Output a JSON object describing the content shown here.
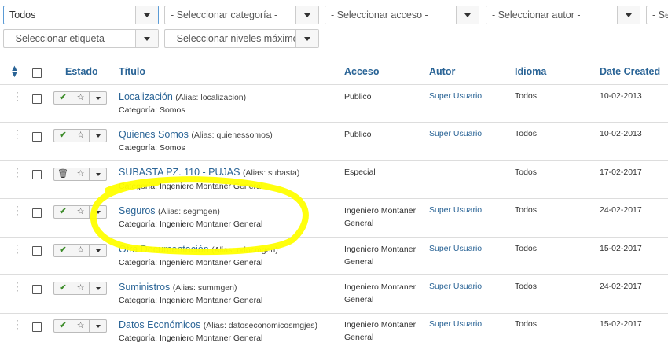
{
  "filters": {
    "status": "Todos",
    "category": "- Seleccionar categoría -",
    "access": "- Seleccionar acceso -",
    "author": "- Seleccionar autor -",
    "language_partial": "- Se",
    "tag": "- Seleccionar etiqueta -",
    "levels": "- Seleccionar niveles máximos"
  },
  "headers": {
    "estado": "Estado",
    "titulo": "Título",
    "acceso": "Acceso",
    "autor": "Autor",
    "idioma": "Idioma",
    "date": "Date Created"
  },
  "rows": [
    {
      "title": "Localización",
      "alias": "(Alias: localizacion)",
      "category": "Categoría: Somos",
      "access": "Publico",
      "author": "Super Usuario",
      "language": "Todos",
      "date": "10-02-2013",
      "state": "published"
    },
    {
      "title": "Quienes Somos",
      "alias": "(Alias: quienessomos)",
      "category": "Categoría: Somos",
      "access": "Publico",
      "author": "Super Usuario",
      "language": "Todos",
      "date": "10-02-2013",
      "state": "published"
    },
    {
      "title": "SUBASTA PZ. 110 - PUJAS",
      "alias": "(Alias: subasta)",
      "category": "Categoría: Ingeniero Montaner General",
      "access": "Especial",
      "author": "",
      "language": "Todos",
      "date": "17-02-2017",
      "state": "trashed"
    },
    {
      "title": "Seguros",
      "alias": "(Alias: segmgen)",
      "category": "Categoría: Ingeniero Montaner General",
      "access": "Ingeniero Montaner General",
      "author": "Super Usuario",
      "language": "Todos",
      "date": "24-02-2017",
      "state": "published"
    },
    {
      "title": "Otra Documentación",
      "alias": "(Alias: odocmgen)",
      "category": "Categoría: Ingeniero Montaner General",
      "access": "Ingeniero Montaner General",
      "author": "Super Usuario",
      "language": "Todos",
      "date": "15-02-2017",
      "state": "published"
    },
    {
      "title": "Suministros",
      "alias": "(Alias: summgen)",
      "category": "Categoría: Ingeniero Montaner General",
      "access": "Ingeniero Montaner General",
      "author": "Super Usuario",
      "language": "Todos",
      "date": "24-02-2017",
      "state": "published"
    },
    {
      "title": "Datos Económicos",
      "alias": "(Alias: datoseconomicosmgjes)",
      "category": "Categoría: Ingeniero Montaner General",
      "access": "Ingeniero Montaner General",
      "author": "Super Usuario",
      "language": "Todos",
      "date": "15-02-2017",
      "state": "published"
    }
  ],
  "icons": {
    "publish": "check-icon",
    "featured": "star-icon",
    "trash": "trash-icon",
    "actions": "caret-down-icon",
    "drag": "drag-handle-icon",
    "sort": "sort-icon"
  },
  "colors": {
    "link": "#2a6496",
    "published": "#3d8c2a",
    "highlight": "#ffff00"
  }
}
